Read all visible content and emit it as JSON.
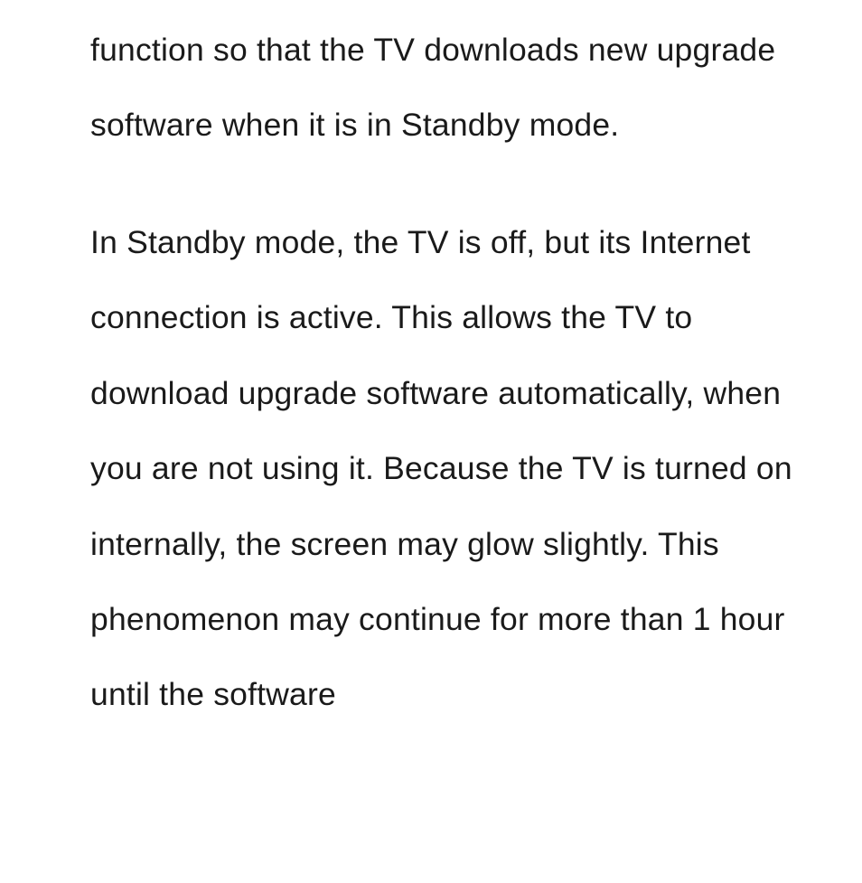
{
  "paragraphs": {
    "p1": "function so that the TV downloads new upgrade software when it is in Standby mode.",
    "p2": "In Standby mode, the TV is off, but its Internet connection is active. This allows the TV to download upgrade software automatically, when you are not using it. Because the TV is turned on internally, the screen may glow slightly. This phenomenon may continue for more than 1 hour until the software"
  }
}
